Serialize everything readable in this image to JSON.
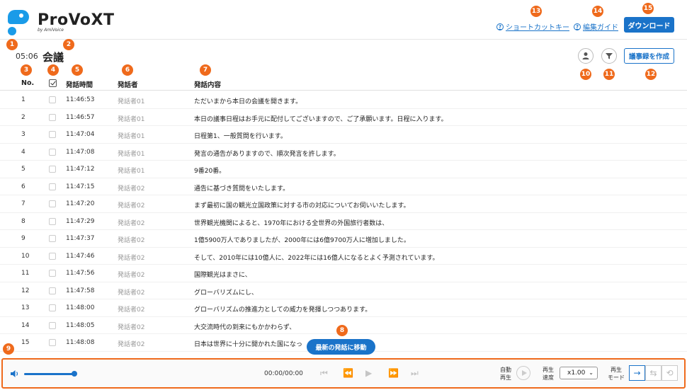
{
  "header": {
    "logo_name": "ProVoXT",
    "logo_sub": "by AmiVoice",
    "shortcut_link": "ショートカットキー",
    "guide_link": "編集ガイド",
    "download_button": "ダウンロード"
  },
  "subheader": {
    "timecode": "05:06",
    "title": "会議",
    "make_minutes_button": "議事録を作成"
  },
  "table": {
    "columns": [
      "No.",
      "",
      "発話時間",
      "発話者",
      "発話内容"
    ],
    "rows": [
      {
        "no": "1",
        "time": "11:46:53",
        "speaker": "発話者01",
        "text": "ただいまから本日の会議を開きます。"
      },
      {
        "no": "2",
        "time": "11:46:57",
        "speaker": "発話者01",
        "text": "本日の議事日程はお手元に配付してございますので、ご了承願います。日程に入ります。"
      },
      {
        "no": "3",
        "time": "11:47:04",
        "speaker": "発話者01",
        "text": "日程第1、一般質問を行います。"
      },
      {
        "no": "4",
        "time": "11:47:08",
        "speaker": "発話者01",
        "text": "発言の通告がありますので、順次発言を許します。"
      },
      {
        "no": "5",
        "time": "11:47:12",
        "speaker": "発話者01",
        "text": "9番20番。"
      },
      {
        "no": "6",
        "time": "11:47:15",
        "speaker": "発話者02",
        "text": "通告に基づき質問をいたします。"
      },
      {
        "no": "7",
        "time": "11:47:20",
        "speaker": "発話者02",
        "text": "まず最初に国の観光立国政策に対する市の対応についてお伺いいたします。"
      },
      {
        "no": "8",
        "time": "11:47:29",
        "speaker": "発話者02",
        "text": "世界観光機関によると、1970年における全世界の外国旅行者数は、"
      },
      {
        "no": "9",
        "time": "11:47:37",
        "speaker": "発話者02",
        "text": "1億5900万人でありましたが、2000年には6億9700万人に増加しました。"
      },
      {
        "no": "10",
        "time": "11:47:46",
        "speaker": "発話者02",
        "text": "そして、2010年には10億人に、2022年には16億人になるとよく予測されています。"
      },
      {
        "no": "11",
        "time": "11:47:56",
        "speaker": "発話者02",
        "text": "国際観光はまさに、"
      },
      {
        "no": "12",
        "time": "11:47:58",
        "speaker": "発話者02",
        "text": "グローバリズムにし、"
      },
      {
        "no": "13",
        "time": "11:48:00",
        "speaker": "発話者02",
        "text": "グローバリズムの推進力としての威力を発揮しつつあります。"
      },
      {
        "no": "14",
        "time": "11:48:05",
        "speaker": "発話者02",
        "text": "大交流時代の到来にもかかわらず、"
      },
      {
        "no": "15",
        "time": "11:48:08",
        "speaker": "発話者02",
        "text": "日本は世界に十分に開かれた国になっ"
      }
    ]
  },
  "latest_button": "最新の発話に移動",
  "player": {
    "time": "00:00/00:00",
    "auto_play_label": [
      "自動",
      "再生"
    ],
    "speed_label": [
      "再生",
      "速度"
    ],
    "speed_value": "x1.00",
    "mode_label": [
      "再生",
      "モード"
    ],
    "volume_level": 1.0
  },
  "markers": [
    "1",
    "2",
    "3",
    "4",
    "5",
    "6",
    "7",
    "8",
    "9",
    "10",
    "11",
    "12",
    "13",
    "14",
    "15"
  ],
  "colors": {
    "accent": "#1a73c9",
    "marker": "#ef6a1c",
    "logo": "#1a9be8"
  }
}
